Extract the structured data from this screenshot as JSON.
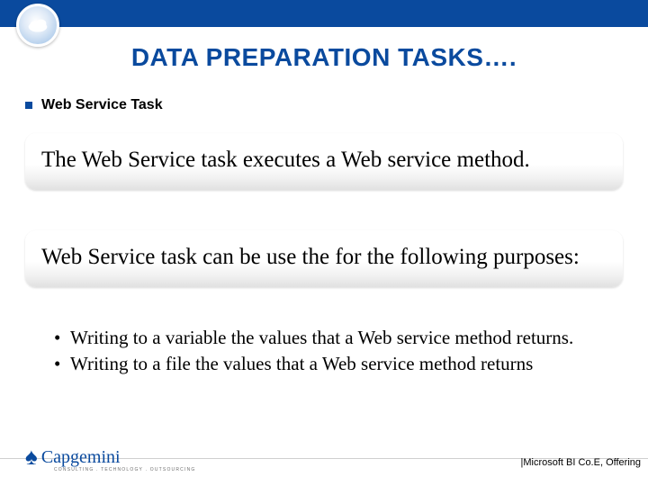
{
  "header": {
    "title": "DATA PREPARATION TASKS…."
  },
  "bullet": {
    "label": "Web Service Task"
  },
  "panels": {
    "p1": "The Web Service task executes a Web service method.",
    "p2": "Web Service task can be use the for the following purposes:"
  },
  "subbullets": {
    "b1": "Writing to a variable the values that a Web service method returns.",
    "b2": "Writing to a file the values that a Web service method returns"
  },
  "footer": {
    "brand": "Capgemini",
    "tagline": "CONSULTING . TECHNOLOGY . OUTSOURCING",
    "right": "|Microsoft BI Co.E, Offering"
  },
  "icons": {
    "topleft": "cloud-circle-logo",
    "footer_spade": "♠"
  },
  "colors": {
    "brand_blue": "#0a4a9e"
  }
}
